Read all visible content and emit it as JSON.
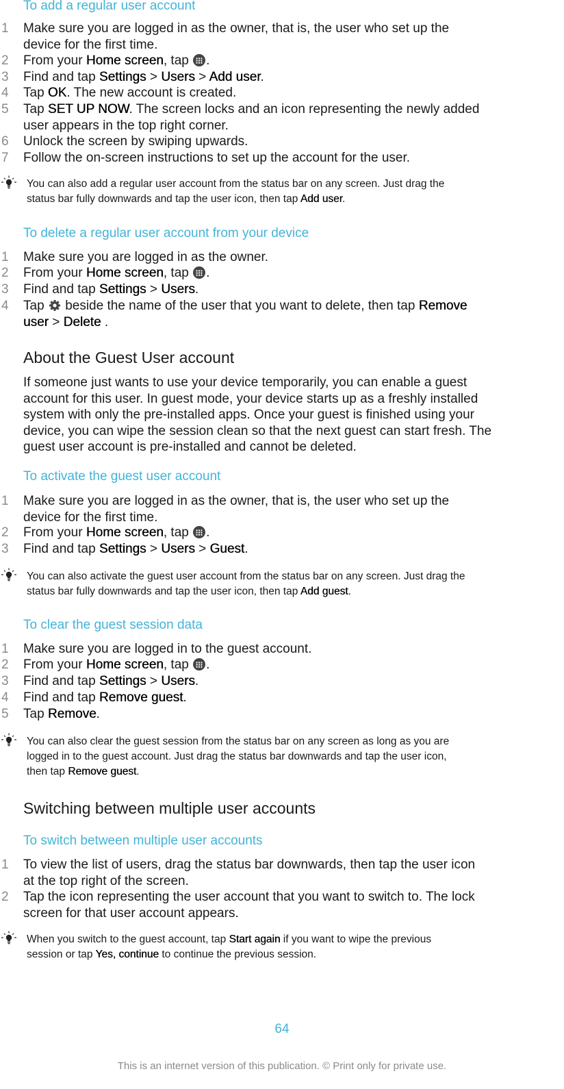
{
  "accent_color": "#42b4d8",
  "sections": {
    "add_regular": {
      "heading": "To add a regular user account",
      "steps": [
        {
          "num": "1",
          "line1": "Make sure you are logged in as the owner, that is, the user who set up the",
          "line2": "device for the first time."
        },
        {
          "num": "2",
          "pre": "From your ",
          "b1": "Home screen",
          "mid": ", tap ",
          "icon": "apps-grid-icon",
          "post": "."
        },
        {
          "num": "3",
          "pre": "Find and tap ",
          "b1": "Settings",
          "s1": " > ",
          "b2": "Users",
          "s2": " > ",
          "b3": "Add user",
          "post": "."
        },
        {
          "num": "4",
          "pre": "Tap ",
          "b1": "OK",
          "post": ". The new account is created."
        },
        {
          "num": "5",
          "pre": "Tap ",
          "b1": "SET UP NOW",
          "post": ". The screen locks and an icon representing the newly added",
          "line2": "user appears in the top right corner."
        },
        {
          "num": "6",
          "text": "Unlock the screen by swiping upwards."
        },
        {
          "num": "7",
          "text": "Follow the on-screen instructions to set up the account for the user."
        }
      ],
      "tip": {
        "line1": "You can also add a regular user account from the status bar on any screen. Just drag the",
        "pre2": "status bar fully downwards and tap the user icon, then tap ",
        "b1": "Add user",
        "post": "."
      }
    },
    "delete_regular": {
      "heading": "To delete a regular user account from your device",
      "steps": [
        {
          "num": "1",
          "text": "Make sure you are logged in as the owner."
        },
        {
          "num": "2",
          "pre": "From your ",
          "b1": "Home screen",
          "mid": ", tap ",
          "icon": "apps-grid-icon",
          "post": "."
        },
        {
          "num": "3",
          "pre": "Find and tap ",
          "b1": "Settings",
          "s1": " > ",
          "b2": "Users",
          "post": "."
        },
        {
          "num": "4",
          "pre": "Tap ",
          "icon": "gear-icon",
          "mid": " beside the name of the user that you want to delete, then tap ",
          "b1": "Remove",
          "b1b": "user",
          "s1": " > ",
          "b2": "Delete",
          "post": " ."
        }
      ]
    },
    "about_guest": {
      "heading": "About the Guest User account",
      "lines": [
        "If someone just wants to use your device temporarily, you can enable a guest",
        "account for this user. In guest mode, your device starts up as a freshly installed",
        "system with only the pre-installed apps. Once your guest is finished using your",
        "device, you can wipe the session clean so that the next guest can start fresh. The",
        "guest user account is pre-installed and cannot be deleted."
      ]
    },
    "activate_guest": {
      "heading": "To activate the guest user account",
      "steps": [
        {
          "num": "1",
          "line1": "Make sure you are logged in as the owner, that is, the user who set up the",
          "line2": "device for the first time."
        },
        {
          "num": "2",
          "pre": "From your ",
          "b1": "Home screen",
          "mid": ", tap ",
          "icon": "apps-grid-icon",
          "post": "."
        },
        {
          "num": "3",
          "pre": "Find and tap ",
          "b1": "Settings",
          "s1": " > ",
          "b2": "Users",
          "s2": " > ",
          "b3": "Guest",
          "post": "."
        }
      ],
      "tip": {
        "line1": "You can also activate the guest user account from the status bar on any screen. Just drag the",
        "pre2": "status bar fully downwards and tap the user icon, then tap ",
        "b1": "Add guest",
        "post": "."
      }
    },
    "clear_guest": {
      "heading": "To clear the guest session data",
      "steps": [
        {
          "num": "1",
          "text": "Make sure you are logged in to the guest account."
        },
        {
          "num": "2",
          "pre": "From your ",
          "b1": "Home screen",
          "mid": ", tap ",
          "icon": "apps-grid-icon",
          "post": "."
        },
        {
          "num": "3",
          "pre": "Find and tap ",
          "b1": "Settings",
          "s1": " > ",
          "b2": "Users",
          "post": "."
        },
        {
          "num": "4",
          "pre": "Find and tap ",
          "b1": "Remove guest",
          "post": "."
        },
        {
          "num": "5",
          "pre": "Tap ",
          "b1": "Remove",
          "post": "."
        }
      ],
      "tip": {
        "line1": "You can also clear the guest session from the status bar on any screen as long as you are",
        "line2": "logged in to the guest account. Just drag the status bar downwards and tap the user icon,",
        "pre3": "then tap ",
        "b1": "Remove guest",
        "post": "."
      }
    },
    "switching": {
      "heading": "Switching between multiple user accounts",
      "subheading": "To switch between multiple user accounts",
      "steps": [
        {
          "num": "1",
          "line1": "To view the list of users, drag the status bar downwards, then tap the user icon",
          "line2": "at the top right of the screen."
        },
        {
          "num": "2",
          "line1": "Tap the icon representing the user account that you want to switch to. The lock",
          "line2": "screen for that user account appears."
        }
      ],
      "tip": {
        "pre1": "When you switch to the guest account, tap ",
        "b1": "Start again",
        "post1": " if you want to wipe the previous",
        "pre2": "session or tap ",
        "b2": "Yes, continue",
        "post2": " to continue the previous session."
      }
    }
  },
  "footer": {
    "page_number": "64",
    "notice": "This is an internet version of this publication. © Print only for private use."
  }
}
